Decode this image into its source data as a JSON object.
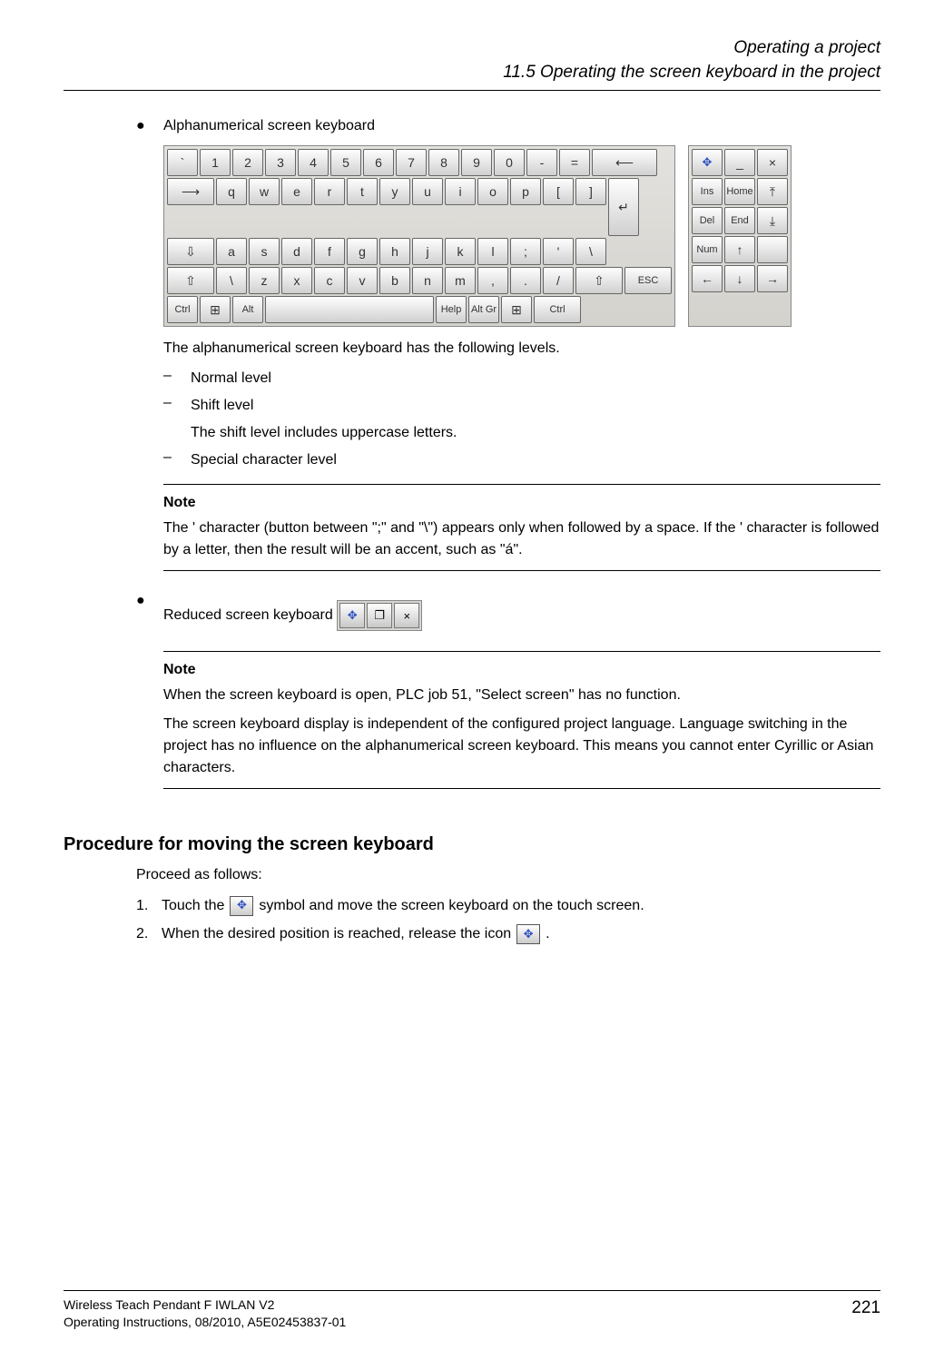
{
  "header": {
    "chapter": "Operating a project",
    "section": "11.5 Operating the screen keyboard in the project"
  },
  "bullets": {
    "alphanumeric_label": "Alphanumerical screen keyboard",
    "reduced_label": "Reduced screen keyboard"
  },
  "keyboard": {
    "row1": [
      "`",
      "1",
      "2",
      "3",
      "4",
      "5",
      "6",
      "7",
      "8",
      "9",
      "0",
      "-",
      "="
    ],
    "row2": [
      "q",
      "w",
      "e",
      "r",
      "t",
      "y",
      "u",
      "i",
      "o",
      "p",
      "[",
      "]"
    ],
    "row3": [
      "a",
      "s",
      "d",
      "f",
      "g",
      "h",
      "j",
      "k",
      "l",
      ";",
      "'",
      "\\"
    ],
    "row4": [
      "\\",
      "z",
      "x",
      "c",
      "v",
      "b",
      "n",
      "m",
      ",",
      ".",
      "/"
    ],
    "row5_ctrl": "Ctrl",
    "row5_alt": "Alt",
    "row5_help": "Help",
    "row5_altgr": "Alt Gr",
    "aux_minimize": "_",
    "aux_close": "×",
    "aux_ins": "Ins",
    "aux_home": "Home",
    "aux_del": "Del",
    "aux_end": "End",
    "aux_num": "Num",
    "aux_esc": "ESC"
  },
  "paras": {
    "levels_intro": "The alphanumerical screen keyboard has the following levels.",
    "normal_level": "Normal level",
    "shift_level": "Shift level",
    "shift_desc": "The shift level includes uppercase letters.",
    "special_level": "Special character level"
  },
  "note1": {
    "label": "Note",
    "text": "The ' character (button between \";\" and \"\\\") appears only when followed by a space. If the ' character is followed by a letter, then the result will be an accent, such as \"á\"."
  },
  "note2": {
    "label": "Note",
    "p1": "When the screen keyboard is open, PLC job 51, \"Select screen\" has no function.",
    "p2": "The screen keyboard display is independent of the configured project language. Language switching in the project has no influence on the alphanumerical screen keyboard. This means you cannot enter Cyrillic or Asian characters."
  },
  "procedure": {
    "heading": "Procedure for moving the screen keyboard",
    "intro": "Proceed as follows:",
    "step1_a": "Touch the",
    "step1_b": "symbol and move the screen keyboard on the touch screen.",
    "step2_a": "When the desired position is reached, release the icon",
    "step2_b": "."
  },
  "footer": {
    "doc": "Wireless Teach Pendant F IWLAN V2",
    "sub": "Operating Instructions, 08/2010, A5E02453837-01",
    "page": "221"
  }
}
